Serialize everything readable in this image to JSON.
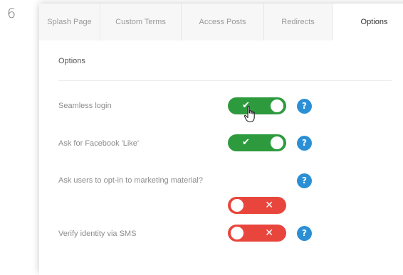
{
  "step_number": "6",
  "tabs": [
    {
      "label": "Splash Page",
      "active": false
    },
    {
      "label": "Custom Terms",
      "active": false
    },
    {
      "label": "Access Posts",
      "active": false
    },
    {
      "label": "Redirects",
      "active": false
    },
    {
      "label": "Options",
      "active": true
    }
  ],
  "section_title": "Options",
  "options": [
    {
      "label": "Seamless login",
      "enabled": true,
      "glyph": "✔"
    },
    {
      "label": "Ask for Facebook 'Like'",
      "enabled": true,
      "glyph": "✔"
    },
    {
      "label": "Ask users to opt-in to marketing material?",
      "enabled": false,
      "glyph": "✕"
    },
    {
      "label": "Verify identity via SMS",
      "enabled": false,
      "glyph": "✕"
    }
  ],
  "help_glyph": "?",
  "colors": {
    "toggle_on": "#2e9a3e",
    "toggle_off": "#e8463d",
    "help": "#2b8fd6"
  }
}
